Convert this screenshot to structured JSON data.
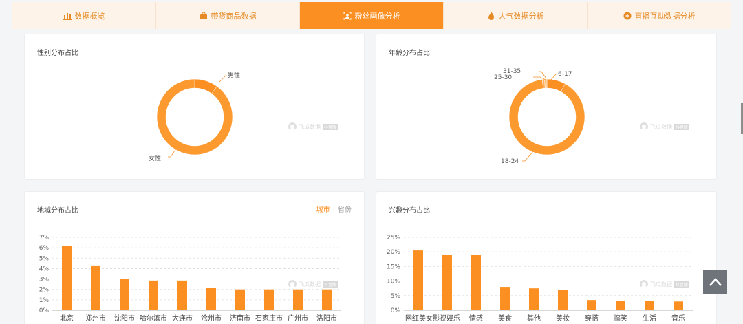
{
  "tabs": [
    {
      "label": "数据概览",
      "icon": "bar-chart-icon"
    },
    {
      "label": "带货商品数据",
      "icon": "shopping-bag-icon"
    },
    {
      "label": "粉丝画像分析",
      "icon": "portrait-scan-icon"
    },
    {
      "label": "人气数据分析",
      "icon": "flame-icon"
    },
    {
      "label": "直播互动数据分析",
      "icon": "interaction-icon"
    }
  ],
  "active_tab": 2,
  "accent_color": "#fb8f22",
  "watermark": {
    "text": "飞瓜数据",
    "tag": "抖音版"
  },
  "gender": {
    "title": "性别分布占比",
    "labels": {
      "male": "男性",
      "female": "女性"
    }
  },
  "age": {
    "title": "年龄分布占比",
    "labels": [
      "6-17",
      "18-24",
      "25-30",
      "31-35"
    ]
  },
  "region": {
    "title": "地域分布占比",
    "toggle_city": "城市",
    "toggle_province": "省份"
  },
  "interest": {
    "title": "兴趣分布占比"
  },
  "chart_data": [
    {
      "type": "pie",
      "title": "性别分布占比",
      "categories": [
        "男性",
        "女性"
      ],
      "values": [
        10,
        90
      ]
    },
    {
      "type": "pie",
      "title": "年龄分布占比",
      "categories": [
        "6-17",
        "18-24",
        "25-30",
        "31-35"
      ],
      "values": [
        8,
        90,
        1,
        1
      ]
    },
    {
      "type": "bar",
      "title": "地域分布占比",
      "categories": [
        "北京",
        "郑州市",
        "沈阳市",
        "哈尔滨市",
        "大连市",
        "沧州市",
        "济南市",
        "石家庄市",
        "广州市",
        "洛阳市"
      ],
      "values": [
        6.2,
        4.3,
        3.0,
        2.85,
        2.85,
        2.15,
        2.0,
        2.0,
        2.0,
        2.0
      ],
      "yticks": [
        "0%",
        "1%",
        "2%",
        "3%",
        "4%",
        "5%",
        "6%",
        "7%"
      ],
      "ylim": [
        0,
        7
      ]
    },
    {
      "type": "bar",
      "title": "兴趣分布占比",
      "categories": [
        "网红美女",
        "影视娱乐",
        "情感",
        "美食",
        "其他",
        "美妆",
        "穿搭",
        "搞笑",
        "生活",
        "音乐"
      ],
      "values": [
        20.5,
        19.0,
        19.0,
        8.0,
        7.5,
        7.0,
        3.5,
        3.2,
        3.2,
        3.0
      ],
      "yticks": [
        "0%",
        "5%",
        "10%",
        "15%",
        "20%",
        "25%"
      ],
      "ylim": [
        0,
        25
      ]
    }
  ]
}
